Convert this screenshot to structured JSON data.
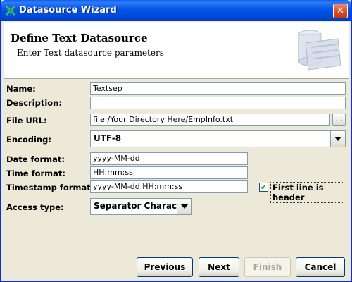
{
  "window": {
    "title": "Datasource Wizard"
  },
  "header": {
    "title": "Define Text Datasource",
    "subtitle": "Enter Text datasource parameters"
  },
  "form": {
    "name_label": "Name:",
    "name_value": "Textsep",
    "description_label": "Description:",
    "description_value": "",
    "file_url_label": "File URL:",
    "file_url_value": "file:/Your Directory Here/EmpInfo.txt",
    "browse_label": "...",
    "encoding_label": "Encoding:",
    "encoding_value": "UTF-8",
    "date_format_label": "Date format:",
    "date_format_value": "yyyy-MM-dd",
    "time_format_label": "Time format:",
    "time_format_value": "HH:mm:ss",
    "timestamp_format_label": "Timestamp format:",
    "timestamp_format_value": "yyyy-MM-dd HH:mm:ss",
    "first_line_header_label": "First line is header",
    "first_line_header_checked": true,
    "access_type_label": "Access type:",
    "access_type_value": "Separator Character"
  },
  "buttons": {
    "previous": "Previous",
    "next": "Next",
    "finish": "Finish",
    "cancel": "Cancel"
  },
  "colors": {
    "titlebar": "#0055e5",
    "field_border": "#7f9db9",
    "dialog_bg": "#ece9d8"
  }
}
